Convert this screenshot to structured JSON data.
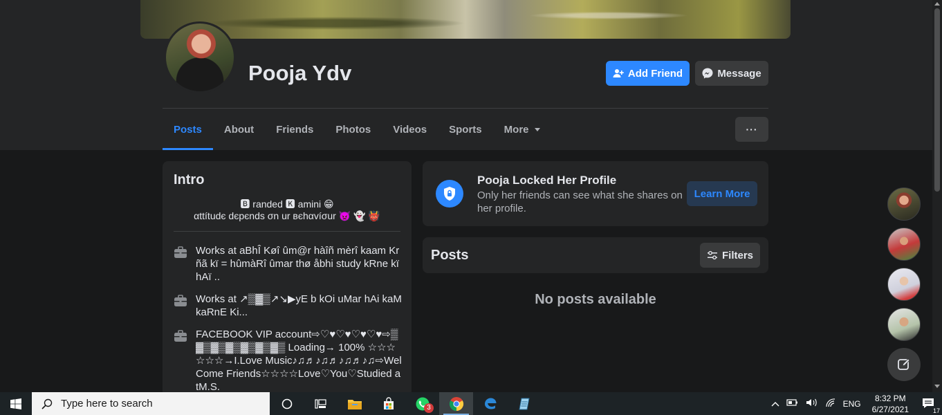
{
  "profile": {
    "name": "Pooja Ydv",
    "add_friend_label": "Add Friend",
    "message_label": "Message",
    "more_dots": "···"
  },
  "tabs": [
    {
      "label": "Posts",
      "active": true
    },
    {
      "label": "About"
    },
    {
      "label": "Friends"
    },
    {
      "label": "Photos"
    },
    {
      "label": "Videos"
    },
    {
      "label": "Sports"
    },
    {
      "label": "More"
    }
  ],
  "intro": {
    "title": "Intro",
    "bio_line1": "🅱 randed 🅺 amini 😁",
    "bio_line2": "αttítudє dєpєnds σn ur вєhαvíσur 👿 👻 👹",
    "work": [
      {
        "text": "Works at aBhÎ Køî ûm@r hàîñ mèrî kaam Krñã kï = hûmàRî ûmar thø åbhi study kRne kï hAï .."
      },
      {
        "text": "Works at ↗▒▓▒↗↘▶yE b kOi uMar hAi kaM kaRnE Ki..."
      },
      {
        "text": "FACEBOOK VIP account⇨♡♥♡♥♡♥♡♥⇨▒▓▒▓▒▓▒▓▒▓▒▓▒ Loading→ 100% ☆☆☆☆☆☆→I.Love Music♪♫♬♪♫♬♪♫♬♪♫⇨WelCome Friends☆☆☆☆Love♡You♡Studied atM.S."
      }
    ]
  },
  "locked": {
    "title": "Pooja Locked Her Profile",
    "subtitle": "Only her friends can see what she shares on her profile.",
    "learn_more": "Learn More"
  },
  "posts": {
    "title": "Posts",
    "filters_label": "Filters",
    "empty_text": "No posts available"
  },
  "taskbar": {
    "search_placeholder": "Type here to search",
    "whatsapp_badge": "3",
    "language": "ENG",
    "time": "8:32 PM",
    "date": "6/27/2021",
    "notification_count": "17"
  }
}
